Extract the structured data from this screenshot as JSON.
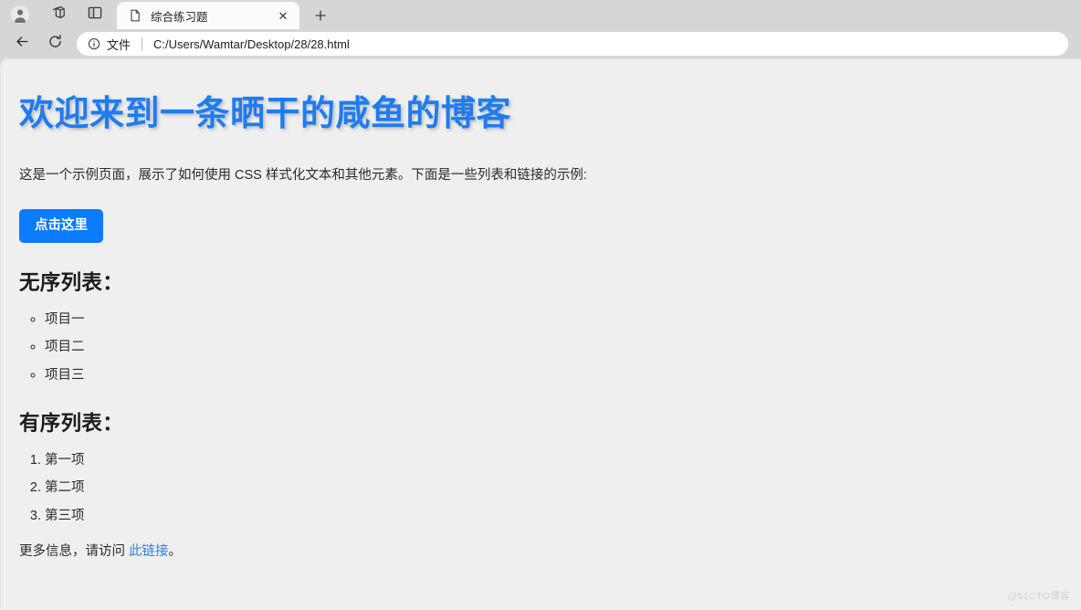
{
  "browser": {
    "chrome_icons": [
      {
        "name": "profile-avatar-icon",
        "label": "profile"
      },
      {
        "name": "collections-icon",
        "label": "collections"
      },
      {
        "name": "split-screen-icon",
        "label": "split-screen"
      }
    ],
    "tab": {
      "favicon": "page-document-icon",
      "title": "综合练习题",
      "close_label": "✕"
    },
    "new_tab_label": "+",
    "toolbar": {
      "back_label": "←",
      "reload_label": "↻",
      "info_icon": "info-circle-icon",
      "scheme_label": "文件",
      "url": "C:/Users/Wamtar/Desktop/28/28.html"
    }
  },
  "page": {
    "title": "欢迎来到一条晒干的咸鱼的博客",
    "intro": "这是一个示例页面，展示了如何使用 CSS 样式化文本和其他元素。下面是一些列表和链接的示例:",
    "button_label": "点击这里",
    "unordered": {
      "heading": "无序列表：",
      "items": [
        "项目一",
        "项目二",
        "项目三"
      ]
    },
    "ordered": {
      "heading": "有序列表：",
      "items": [
        "第一项",
        "第二项",
        "第三项"
      ]
    },
    "more": {
      "prefix": "更多信息，请访问 ",
      "link_text": "此链接",
      "suffix": "。"
    }
  },
  "watermark": "@51CTO博客",
  "colors": {
    "heading_blue": "#1e7cf0",
    "button_blue": "#0a7cfd",
    "link_blue": "#2f7fe0",
    "page_bg": "#efefef",
    "chrome_bg": "#d6d6d6"
  }
}
